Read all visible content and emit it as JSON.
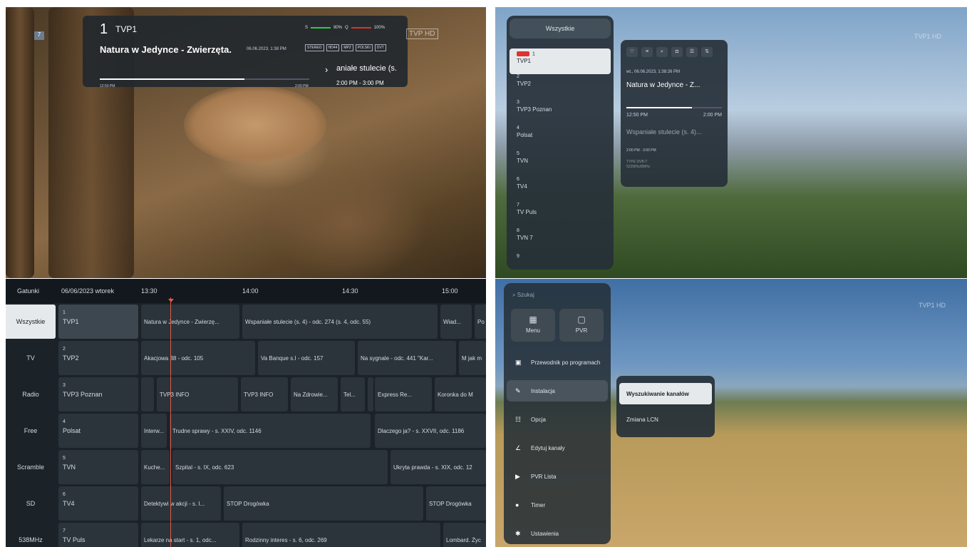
{
  "panel1": {
    "badge": "7",
    "channel_number": "1",
    "channel_name": "TVP1",
    "program_title": "Natura w Jedynce - Zwierzęta.",
    "date_time": "06.06.2023, 1:38 PM",
    "tags": [
      "STEREO",
      "HD44",
      "MP2",
      "POLSKI",
      "DVT"
    ],
    "signal_s": "S",
    "signal_s_value": "90%",
    "signal_q": "Q",
    "signal_q_value": "100%",
    "next_program": "aniałe stulecie (s.",
    "next_time": "2:00 PM - 3:00 PM",
    "progress_start": "12:50 PM",
    "progress_end": "2:00 PM",
    "progress_fraction": 0.69,
    "corner_logo": "TVP HD",
    "signal_s_color": "#2ecc40",
    "signal_q_color": "#e03030"
  },
  "panel2": {
    "list_header": "Wszystkie",
    "channels": [
      {
        "num": "1",
        "name": "TVP1"
      },
      {
        "num": "2",
        "name": "TVP2"
      },
      {
        "num": "3",
        "name": "TVP3 Poznan"
      },
      {
        "num": "4",
        "name": "Polsat"
      },
      {
        "num": "5",
        "name": "TVN"
      },
      {
        "num": "6",
        "name": "TV4"
      },
      {
        "num": "7",
        "name": "TV Puls"
      },
      {
        "num": "8",
        "name": "TVN 7"
      },
      {
        "num": "9",
        "name": ""
      }
    ],
    "date_time": "wt., 06.06.2023, 1:38:26 PM",
    "title": "Natura w Jedynce - Z...",
    "start": "12:50 PM",
    "end": "2:00 PM",
    "progress_fraction": 0.69,
    "next": "Wspaniałe stulecie (s. 4)...",
    "next_time": "2:00 PM - 3:00 PM",
    "type_line1": "TYPE DVB-T",
    "type_line2": "522MHz/8MHz",
    "corner_logo": "TVP1 HD"
  },
  "panel3": {
    "header": {
      "genres": "Gatunki",
      "date": "06/06/2023 wtorek",
      "t1": "13:30",
      "t2": "14:00",
      "t3": "14:30",
      "t4": "15:00"
    },
    "categories": [
      "Wszystkie",
      "TV",
      "Radio",
      "Free",
      "Scramble",
      "SD",
      "538MHz"
    ],
    "channels": [
      {
        "num": "1",
        "name": "TVP1"
      },
      {
        "num": "2",
        "name": "TVP2"
      },
      {
        "num": "3",
        "name": "TVP3 Poznan"
      },
      {
        "num": "4",
        "name": "Polsat"
      },
      {
        "num": "5",
        "name": "TVN"
      },
      {
        "num": "6",
        "name": "TV4"
      },
      {
        "num": "7",
        "name": "TV Puls"
      }
    ],
    "programs": [
      [
        "Natura w Jedynce - Zwierzę...",
        "Wspaniałe stulecie (s. 4) - odc. 274 (s. 4, odc. 55)",
        "Wiad...",
        "Po"
      ],
      [
        "Akacjowa 38 - odc. 105",
        "Va Banque s.I - odc. 157",
        "Na sygnale - odc. 441 \"Kar...",
        "M jak m"
      ],
      [
        "",
        "TVP3 INFO",
        "TVP3 INFO",
        "Na Zdrowie...",
        "Tel...",
        "",
        "Express Re...",
        "Koronka do M"
      ],
      [
        "Interw...",
        "Trudne sprawy - s. XXIV, odc. 1146",
        "Dlaczego ja? - s. XXVII, odc. 1186"
      ],
      [
        "Kuche...",
        "Szpital - s. IX, odc. 623",
        "Ukryta prawda - s. XIX, odc. 12"
      ],
      [
        "Detektywi w akcji - s. I...",
        "STOP Drogówka",
        "STOP Drogówka"
      ],
      [
        "Lekarze na start - s. 1, odc...",
        "Rodzinny interes - s. 6, odc. 269",
        "Lombard. Życ"
      ]
    ]
  },
  "panel4": {
    "search_placeholder": "Szukaj",
    "tiles": [
      {
        "icon": "grid-icon",
        "label": "Menu"
      },
      {
        "icon": "camera-icon",
        "label": "PVR"
      }
    ],
    "menu_items": [
      "Przewodnik po programach",
      "Instalacja",
      "Opcja",
      "Edytuj kanały",
      "PVR Lista",
      "Timer",
      "Ustawienia"
    ],
    "submenu": [
      "Wyszukiwanie kanałów",
      "Zmiana LCN"
    ],
    "corner_logo": "TVP1 HD"
  }
}
